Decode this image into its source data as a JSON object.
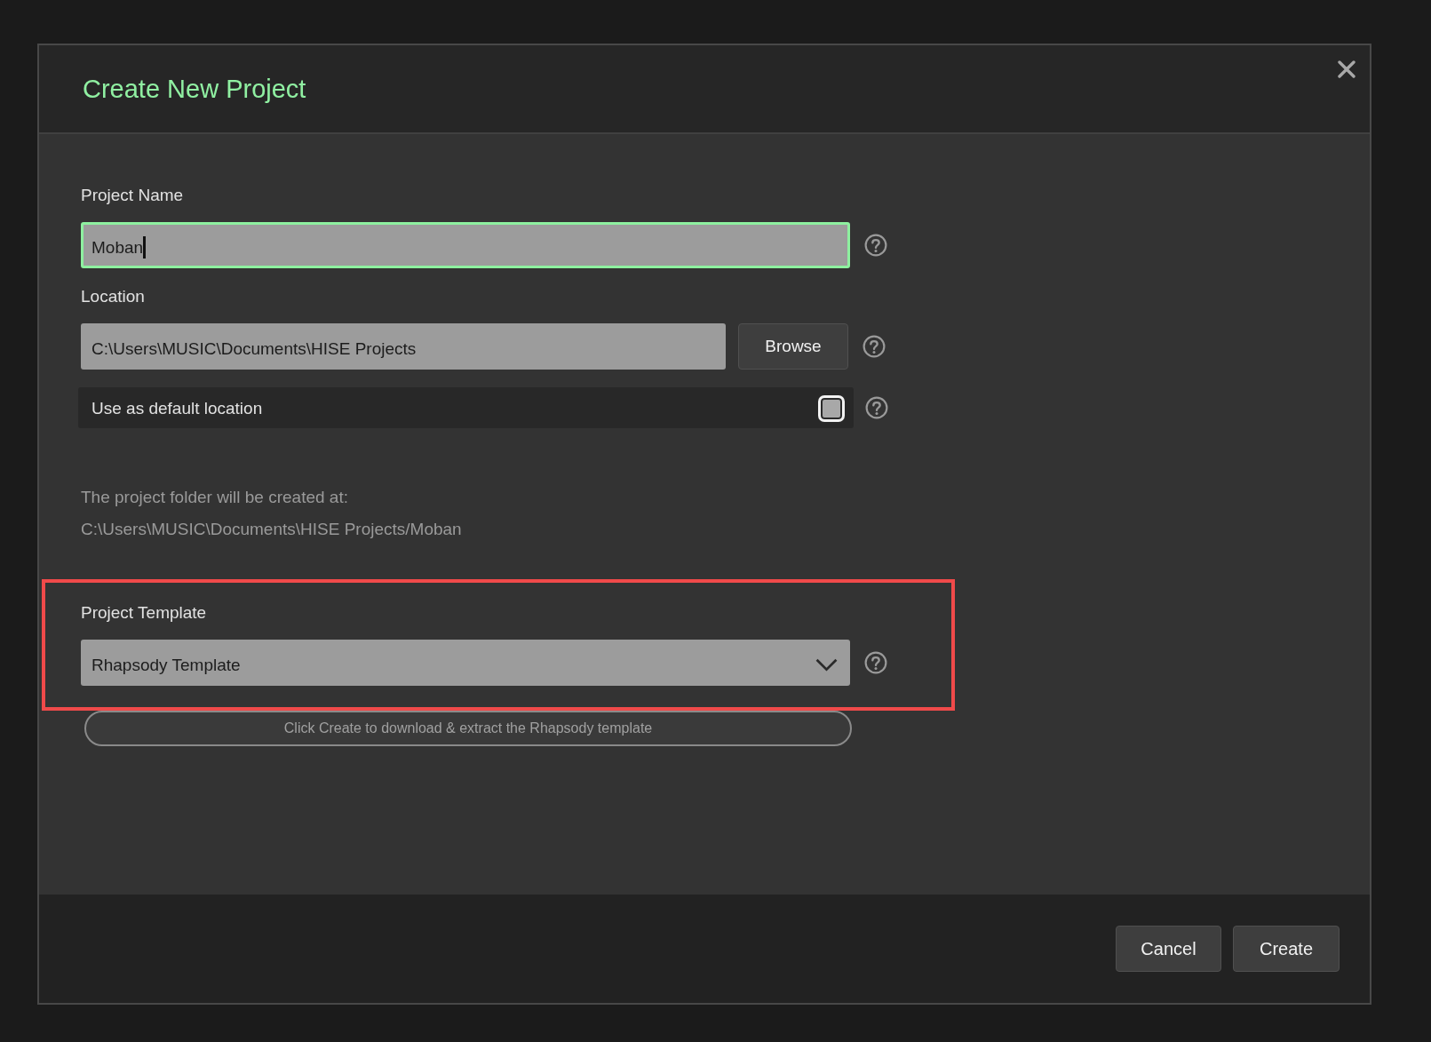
{
  "dialog": {
    "title": "Create New Project"
  },
  "project_name": {
    "label": "Project Name",
    "value": "Moban",
    "focused": true
  },
  "location": {
    "label": "Location",
    "value": "C:\\Users\\MUSIC\\Documents\\HISE Projects",
    "button": "Browse"
  },
  "default_location": {
    "label": "Use as default location",
    "checked": false
  },
  "destination": {
    "caption": "The project folder will be created at:",
    "path": "C:\\Users\\MUSIC\\Documents\\HISE Projects/Moban"
  },
  "template": {
    "label": "Project Template",
    "value": "Rhapsody Template",
    "highlighted": true,
    "note": "Click Create to download & extract the Rhapsody template"
  },
  "buttons": [
    "Cancel",
    "Create"
  ]
}
